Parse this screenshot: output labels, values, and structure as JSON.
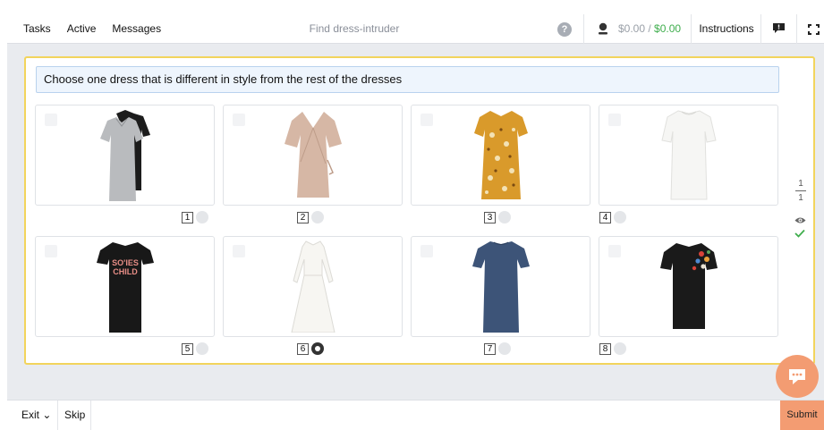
{
  "topbar": {
    "nav": [
      "Tasks",
      "Active",
      "Messages"
    ],
    "title": "Find dress-intruder",
    "help": "?",
    "money_spent": "$0.00",
    "money_sep": " / ",
    "money_earned": "$0.00",
    "instructions": "Instructions"
  },
  "task": {
    "question": "Choose one dress that is different in style from the rest of the dresses",
    "items": [
      {
        "number": "1",
        "selected": false,
        "dress": "grey-and-black-tshirt-dresses"
      },
      {
        "number": "2",
        "selected": false,
        "dress": "beige-wrap-dress"
      },
      {
        "number": "3",
        "selected": false,
        "dress": "mustard-floral-dress"
      },
      {
        "number": "4",
        "selected": false,
        "dress": "white-tunic-dress"
      },
      {
        "number": "5",
        "selected": false,
        "dress": "black-graphic-tshirt-dress"
      },
      {
        "number": "6",
        "selected": true,
        "dress": "white-long-sleeve-maxi-dress"
      },
      {
        "number": "7",
        "selected": false,
        "dress": "navy-shift-dress"
      },
      {
        "number": "8",
        "selected": false,
        "dress": "black-embroidered-tshirt-dress"
      }
    ],
    "graphic_text": [
      "SO'IES",
      "CHILD"
    ]
  },
  "pager": {
    "current": "1",
    "total": "1"
  },
  "bottombar": {
    "exit": "Exit",
    "skip": "Skip",
    "submit": "Submit"
  },
  "colors": {
    "accent": "#f39c72",
    "panel_border": "#f2d45c",
    "earned": "#3fae4d",
    "question_bg": "#eef5fd"
  }
}
